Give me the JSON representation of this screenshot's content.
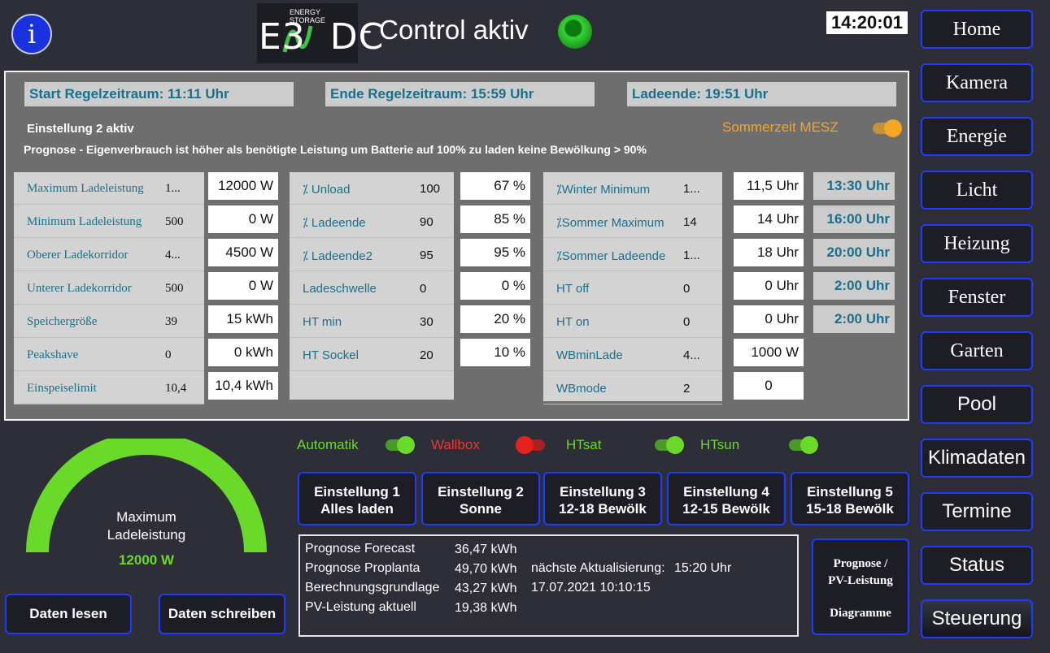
{
  "header": {
    "info_icon_glyph": "i",
    "logo_text": "E3DC",
    "logo_subtext": "ENERGY STORAGE",
    "title": "- Control aktiv",
    "status_led_color": "#36d336",
    "clock": "14:20:01"
  },
  "nav": [
    {
      "label": "Home",
      "font": "serif"
    },
    {
      "label": "Kamera",
      "font": "serif"
    },
    {
      "label": "Energie",
      "font": "serif"
    },
    {
      "label": "Licht",
      "font": "serif"
    },
    {
      "label": "Heizung",
      "font": "serif"
    },
    {
      "label": "Fenster",
      "font": "serif"
    },
    {
      "label": "Garten",
      "font": "serif"
    },
    {
      "label": "Pool",
      "font": "sans"
    },
    {
      "label": "Klimadaten",
      "font": "sans"
    },
    {
      "label": "Termine",
      "font": "sans"
    },
    {
      "label": "Status",
      "font": "sans"
    },
    {
      "label": "Steuerung",
      "font": "sans",
      "active": true
    }
  ],
  "panel": {
    "start": "Start Regelzeitraum: 11:11 Uhr",
    "ende": "Ende Regelzeitraum: 15:59 Uhr",
    "ladeende": "Ladeende: 19:51 Uhr",
    "einstellung_aktiv": "Einstellung 2 aktiv",
    "prognose": "Prognose - Eigenverbrauch ist höher als benötigte Leistung um Batterie auf 100% zu laden keine Bewölkung > 90%",
    "sommerzeit_label": "Sommerzeit MESZ",
    "sommerzeit_on": true
  },
  "col1": [
    {
      "label": "Maximum Ladeleistung",
      "value": "1...",
      "input": "12000 W"
    },
    {
      "label": "Minimum Ladeleistung",
      "value": "500",
      "input": "0 W"
    },
    {
      "label": "Oberer Ladekorridor",
      "value": "4...",
      "input": "4500 W"
    },
    {
      "label": "Unterer Ladekorridor",
      "value": "500",
      "input": "0 W"
    },
    {
      "label": "Speichergröße",
      "value": "39",
      "input": "15 kWh"
    },
    {
      "label": "Peakshave",
      "value": "0",
      "input": "0 kWh"
    },
    {
      "label": "Einspeiselimit",
      "value": "10,4",
      "input": "10,4 kWh"
    }
  ],
  "col2": [
    {
      "label": "⁒ Unload",
      "value": "100",
      "input": "67 %"
    },
    {
      "label": "⁒ Ladeende",
      "value": "90",
      "input": "85 %"
    },
    {
      "label": "⁒ Ladeende2",
      "value": "95",
      "input": "95 %"
    },
    {
      "label": "Ladeschwelle",
      "value": "0",
      "input": "0 %"
    },
    {
      "label": "HT min",
      "value": "30",
      "input": "20 %"
    },
    {
      "label": "HT Sockel",
      "value": "20",
      "input": "10 %"
    }
  ],
  "col3": [
    {
      "label": "⁒Winter Minimum",
      "value": "1...",
      "input": "11,5 Uhr",
      "time": "13:30 Uhr"
    },
    {
      "label": "⁒Sommer Maximum",
      "value": "14",
      "input": "14 Uhr",
      "time": "16:00 Uhr"
    },
    {
      "label": "⁒Sommer Ladeende",
      "value": "1...",
      "input": "18 Uhr",
      "time": "20:00 Uhr"
    },
    {
      "label": "HT off",
      "value": "0",
      "input": "0 Uhr",
      "time": "2:00 Uhr"
    },
    {
      "label": "HT on",
      "value": "0",
      "input": "0 Uhr",
      "time": "2:00 Uhr"
    },
    {
      "label": "WBminLade",
      "value": "4...",
      "input": "1000 W"
    },
    {
      "label": "WBmode",
      "value": "2",
      "input": "0"
    }
  ],
  "switches": [
    {
      "label": "Automatik",
      "label_color": "#6bd92a",
      "on": true
    },
    {
      "label": "Wallbox",
      "label_color": "#e43a3a",
      "on": false
    },
    {
      "label": "HTsat",
      "label_color": "#6bd92a",
      "on": true
    },
    {
      "label": "HTsun",
      "label_color": "#6bd92a",
      "on": true
    }
  ],
  "settings": [
    {
      "line1": "Einstellung 1",
      "line2": "Alles laden"
    },
    {
      "line1": "Einstellung 2",
      "line2": "Sonne"
    },
    {
      "line1": "Einstellung 3",
      "line2": "12-18 Bewölk"
    },
    {
      "line1": "Einstellung 4",
      "line2": "12-15 Bewölk"
    },
    {
      "line1": "Einstellung 5",
      "line2": "15-18 Bewölk"
    }
  ],
  "forecast": {
    "rows": [
      {
        "label": "Prognose Forecast",
        "value": "36,47 kWh"
      },
      {
        "label": "Prognose Proplanta",
        "value": "49,70 kWh"
      },
      {
        "label": "Berechnungsgrundlage",
        "value": "43,27 kWh"
      },
      {
        "label": "PV-Leistung aktuell",
        "value": "19,38 kWh"
      }
    ],
    "next_update_label": "nächste Aktualisierung:",
    "next_update_time": "15:20 Uhr",
    "timestamp": "17.07.2021 10:10:15"
  },
  "diagram_button": {
    "line1": "Prognose /",
    "line2": "PV-Leistung",
    "line3": "Diagramme"
  },
  "gauge": {
    "title_line1": "Maximum",
    "title_line2": "Ladeleistung",
    "value": "12000 W",
    "fill_fraction": 1.0,
    "color": "#6bd92a"
  },
  "buttons": {
    "read": "Daten lesen",
    "write": "Daten schreiben"
  }
}
